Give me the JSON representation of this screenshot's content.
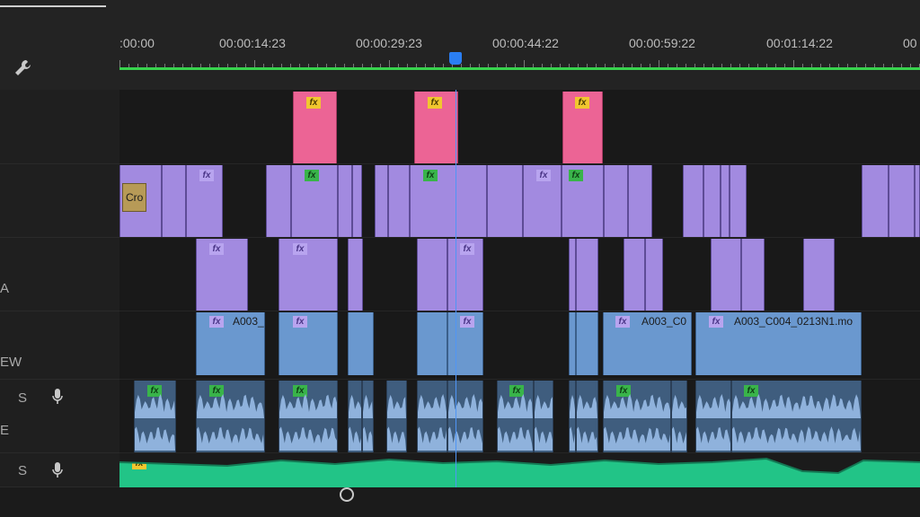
{
  "ruler": {
    "timecodes": [
      ":00:00",
      "00:00:14:23",
      "00:00:29:23",
      "00:00:44:22",
      "00:00:59:22",
      "00:01:14:22",
      "00"
    ]
  },
  "track_headers": {
    "v3_label": "A",
    "v2_label": "EW",
    "a1_solo": "S",
    "a1_name": "E",
    "a2_solo": "S"
  },
  "clips": {
    "v1_first_label": "Cro",
    "v1_blue_1": "A003_",
    "v1_blue_2": "A003_C0",
    "v1_blue_3": "A003_C004_0213N1.mo"
  },
  "badges": {
    "fx": "fx"
  },
  "colors": {
    "background": "#1d1d1d",
    "timeline_green": "#37d34d",
    "playhead": "#2a7ef2",
    "adjustment_clip": "#ec6495",
    "video_clip_purple": "#a28ae0",
    "video_clip_blue": "#6a98cf",
    "audio_clip": "#3f5d7e",
    "music_track": "#22c487"
  },
  "icons": [
    "wrench-icon",
    "microphone-icon",
    "scroll-knob-icon"
  ]
}
